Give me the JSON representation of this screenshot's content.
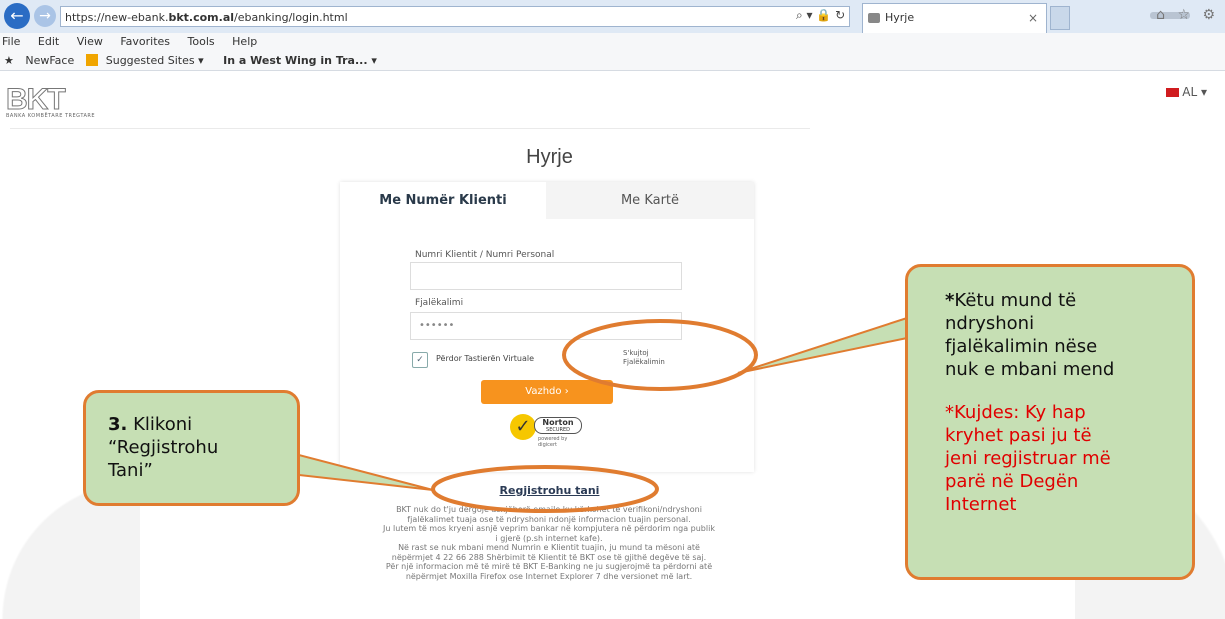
{
  "browser": {
    "url_prefix": "https://new-ebank.",
    "url_host": "bkt.com.al",
    "url_path": "/ebanking/login.html",
    "address_controls": "⌕ ▾ 🔒 ↻",
    "tab_title": "Hyrje",
    "tab_close": "×",
    "back_icon": "back-arrow-icon",
    "forward_icon": "forward-arrow-icon",
    "toolbar_icons": "⌂ ☆ ⚙"
  },
  "menu": [
    "File",
    "Edit",
    "View",
    "Favorites",
    "Tools",
    "Help"
  ],
  "favorites_bar": {
    "item1": "NewFace",
    "item2": "Suggested Sites ▾",
    "item3": "In a West Wing in Tra... ▾"
  },
  "site": {
    "logo_text": "BKT",
    "logo_subtitle": "BANKA KOMBËTARE TREGTARE",
    "language": "AL ▾",
    "page_title": "Hyrje"
  },
  "login": {
    "tab_active": "Me Numër Klienti",
    "tab_inactive": "Me Kartë",
    "client_label": "Numri Klientit / Numri Personal",
    "client_value": "",
    "password_label": "Fjalëkalimi",
    "password_value": "••••••",
    "virtual_keyboard_checked": "✓",
    "virtual_keyboard_label": "Përdor Tastierën Virtuale",
    "forgot_line1": "S'kujtoj",
    "forgot_line2": "Fjalëkalimin",
    "continue_button": "Vazhdo ›",
    "norton_name": "Norton",
    "norton_secured": "SECURED",
    "norton_powered": "powered by digicert",
    "register_link": "Regjistrohu tani"
  },
  "footer_lines": [
    "BKT nuk do t'ju dërgojë asnjëherë emaile ku kërkohet të verifikoni/ndryshoni",
    "fjalëkalimet tuaja ose të ndryshoni ndonjë informacion tuajin personal.",
    "Ju lutem të mos kryeni asnjë veprim bankar në kompjutera në përdorim nga publik",
    "i gjerë (p.sh internet kafe).",
    "Në rast se nuk mbani mend Numrin e Klientit tuajin, ju mund ta mësoni atë",
    "nëpërmjet 4 22 66 288 Shërbimit të Klientit të BKT ose të gjithë degëve të saj.",
    "Për një informacion më të mirë të BKT E-Banking ne ju sugjerojmë ta përdorni atë",
    "nëpërmjet Moxilla Firefox ose Internet Explorer 7 dhe versionet më lart."
  ],
  "callouts": {
    "left_number": "3.",
    "left_text1": "Klikoni",
    "left_text2": "“Regjistrohu",
    "left_text3": "Tani”",
    "right_star": "*",
    "right_line1": "Këtu mund të",
    "right_line2": "ndryshoni",
    "right_line3": "fjalëkalimin nëse",
    "right_line4": "nuk e mbani mend",
    "warn_line1": "*Kujdes: Ky hap",
    "warn_line2": "kryhet pasi ju të",
    "warn_line3": "jeni regjistruar më",
    "warn_line4": "parë në Degën",
    "warn_line5": "Internet"
  },
  "colors": {
    "accent_orange": "#f7931e",
    "callout_fill": "#c6dfb4",
    "callout_border": "#e07c30",
    "warning_red": "#e00000"
  }
}
